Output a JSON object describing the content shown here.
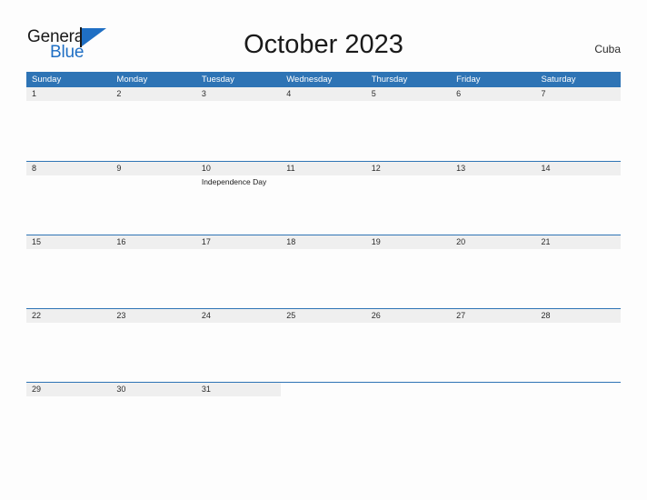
{
  "logo": {
    "word_one": "General",
    "word_two": "Blue",
    "mark": "blue-triangle-logo-mark"
  },
  "header": {
    "title": "October 2023",
    "region": "Cuba"
  },
  "colors": {
    "header_blue": "#2e74b5",
    "logo_blue": "#1f6fc4",
    "date_strip_gray": "#efefef",
    "page_background": "#fdfdfd",
    "text_dark": "#1a1a1a"
  },
  "calendar": {
    "weekdays": [
      "Sunday",
      "Monday",
      "Tuesday",
      "Wednesday",
      "Thursday",
      "Friday",
      "Saturday"
    ],
    "weeks": [
      {
        "days": [
          {
            "date": "1",
            "event": ""
          },
          {
            "date": "2",
            "event": ""
          },
          {
            "date": "3",
            "event": ""
          },
          {
            "date": "4",
            "event": ""
          },
          {
            "date": "5",
            "event": ""
          },
          {
            "date": "6",
            "event": ""
          },
          {
            "date": "7",
            "event": ""
          }
        ]
      },
      {
        "days": [
          {
            "date": "8",
            "event": ""
          },
          {
            "date": "9",
            "event": ""
          },
          {
            "date": "10",
            "event": "Independence Day"
          },
          {
            "date": "11",
            "event": ""
          },
          {
            "date": "12",
            "event": ""
          },
          {
            "date": "13",
            "event": ""
          },
          {
            "date": "14",
            "event": ""
          }
        ]
      },
      {
        "days": [
          {
            "date": "15",
            "event": ""
          },
          {
            "date": "16",
            "event": ""
          },
          {
            "date": "17",
            "event": ""
          },
          {
            "date": "18",
            "event": ""
          },
          {
            "date": "19",
            "event": ""
          },
          {
            "date": "20",
            "event": ""
          },
          {
            "date": "21",
            "event": ""
          }
        ]
      },
      {
        "days": [
          {
            "date": "22",
            "event": ""
          },
          {
            "date": "23",
            "event": ""
          },
          {
            "date": "24",
            "event": ""
          },
          {
            "date": "25",
            "event": ""
          },
          {
            "date": "26",
            "event": ""
          },
          {
            "date": "27",
            "event": ""
          },
          {
            "date": "28",
            "event": ""
          }
        ]
      },
      {
        "days": [
          {
            "date": "29",
            "event": ""
          },
          {
            "date": "30",
            "event": ""
          },
          {
            "date": "31",
            "event": ""
          },
          {
            "date": "",
            "event": ""
          },
          {
            "date": "",
            "event": ""
          },
          {
            "date": "",
            "event": ""
          },
          {
            "date": "",
            "event": ""
          }
        ]
      }
    ]
  }
}
